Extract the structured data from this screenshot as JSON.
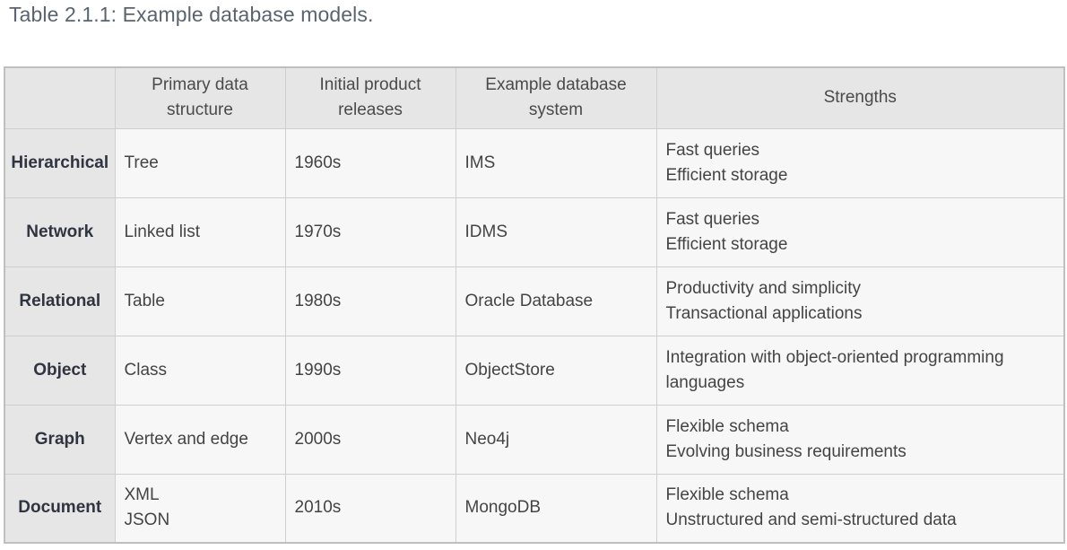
{
  "caption": "Table 2.1.1: Example database models.",
  "table": {
    "headers": [
      "",
      "Primary data structure",
      "Initial product releases",
      "Example database system",
      "Strengths"
    ],
    "header_lines": [
      [],
      [
        "Primary data",
        "structure"
      ],
      [
        "Initial product",
        "releases"
      ],
      [
        "Example database",
        "system"
      ],
      [
        "Strengths"
      ]
    ],
    "rows": [
      {
        "model": "Hierarchical",
        "structure": [
          "Tree"
        ],
        "release": "1960s",
        "example": "IMS",
        "strengths": [
          "Fast queries",
          "Efficient storage"
        ]
      },
      {
        "model": "Network",
        "structure": [
          "Linked list"
        ],
        "release": "1970s",
        "example": "IDMS",
        "strengths": [
          "Fast queries",
          "Efficient storage"
        ]
      },
      {
        "model": "Relational",
        "structure": [
          "Table"
        ],
        "release": "1980s",
        "example": "Oracle Database",
        "strengths": [
          "Productivity and simplicity",
          "Transactional applications"
        ]
      },
      {
        "model": "Object",
        "structure": [
          "Class"
        ],
        "release": "1990s",
        "example": "ObjectStore",
        "strengths": [
          "Integration with object-oriented programming",
          "languages"
        ]
      },
      {
        "model": "Graph",
        "structure": [
          "Vertex and edge"
        ],
        "release": "2000s",
        "example": "Neo4j",
        "strengths": [
          "Flexible schema",
          "Evolving business requirements"
        ]
      },
      {
        "model": "Document",
        "structure": [
          "XML",
          "JSON"
        ],
        "release": "2010s",
        "example": "MongoDB",
        "strengths": [
          "Flexible schema",
          "Unstructured and semi-structured data"
        ]
      }
    ]
  }
}
